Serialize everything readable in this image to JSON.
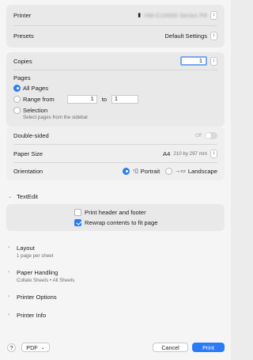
{
  "printer": {
    "label": "Printer",
    "value": "HM-C10000 Series P8"
  },
  "presets": {
    "label": "Presets",
    "value": "Default Settings"
  },
  "copies": {
    "label": "Copies",
    "value": "1"
  },
  "pages": {
    "label": "Pages",
    "all_pages": "All Pages",
    "range_from": "Range from",
    "range_start": "1",
    "range_to": "to",
    "range_end": "1",
    "selection": "Selection",
    "selection_hint": "Select pages from the sidebar"
  },
  "double_sided": {
    "label": "Double-sided",
    "value": "Off"
  },
  "paper_size": {
    "label": "Paper Size",
    "value": "A4",
    "dims": "210 by 297 mm"
  },
  "orientation": {
    "label": "Orientation",
    "portrait": "Portrait",
    "landscape": "Landscape"
  },
  "textedit": {
    "title": "TextEdit",
    "print_header": "Print header and footer",
    "rewrap": "Rewrap contents to fit page"
  },
  "layout": {
    "title": "Layout",
    "subtitle": "1 page per sheet"
  },
  "paper_handling": {
    "title": "Paper Handling",
    "subtitle": "Collate Sheets • All Sheets"
  },
  "printer_options": {
    "title": "Printer Options"
  },
  "printer_info": {
    "title": "Printer Info"
  },
  "footer": {
    "help": "?",
    "pdf": "PDF",
    "cancel": "Cancel",
    "print": "Print"
  },
  "colors": {
    "accent": "#2a7cf6"
  }
}
